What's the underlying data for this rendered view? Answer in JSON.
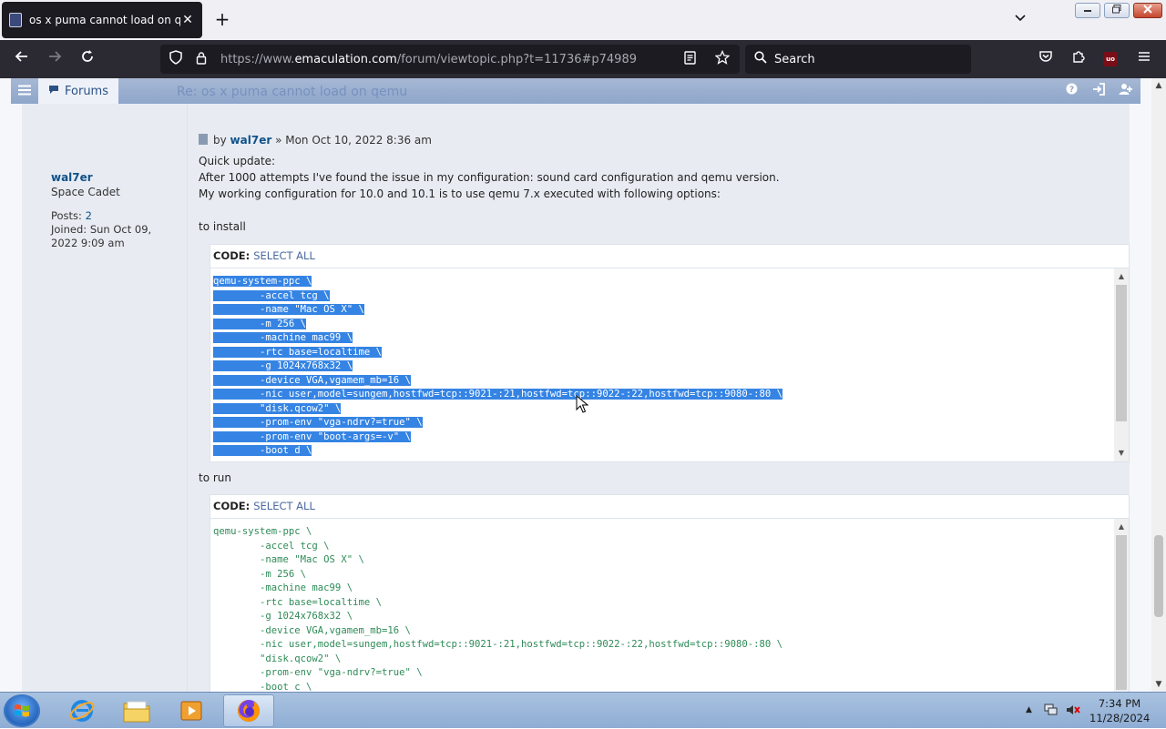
{
  "browser": {
    "tab_title": "os x puma cannot load on qemu",
    "tab_close": "✕",
    "new_tab": "+",
    "url_prefix": "https://www.",
    "url_domain": "emaculation.com",
    "url_rest": "/forum/viewtopic.php?t=11736#p74989",
    "search_placeholder": "Search",
    "ublock_label": "uo"
  },
  "forum_nav": {
    "forums_label": "Forums",
    "ghost_title": "Re: os x puma cannot load on qemu"
  },
  "post": {
    "meta_by": "by",
    "author": "wal7er",
    "meta_date": "» Mon Oct 10, 2022 8:36 am",
    "profile": {
      "username": "wal7er",
      "rank": "Space Cadet",
      "posts_label": "Posts:",
      "posts_count": "2",
      "joined": "Joined: Sun Oct 09, 2022 9:09 am"
    },
    "paragraphs": [
      "Quick update:",
      "After 1000 attempts I've found the issue in my configuration: sound card configuration and qemu version.",
      "My working configuration for 10.0 and 10.1 is to use qemu 7.x executed with following options:"
    ],
    "install_label": "to install",
    "run_label": "to run",
    "code_label": "CODE:",
    "select_all": "SELECT ALL",
    "install_code": [
      "qemu-system-ppc \\",
      "        -accel tcg \\",
      "        -name \"Mac OS X\" \\",
      "        -m 256 \\",
      "        -machine mac99 \\",
      "        -rtc base=localtime \\",
      "        -g 1024x768x32 \\",
      "        -device VGA,vgamem_mb=16 \\",
      "        -nic user,model=sungem,hostfwd=tcp::9021-:21,hostfwd=tcp::9022-:22,hostfwd=tcp::9080-:80 \\",
      "        \"disk.qcow2\" \\",
      "        -prom-env \"vga-ndrv?=true\" \\",
      "        -prom-env \"boot-args=-v\" \\",
      "        -boot d \\"
    ],
    "run_code": [
      "qemu-system-ppc \\",
      "        -accel tcg \\",
      "        -name \"Mac OS X\" \\",
      "        -m 256 \\",
      "        -machine mac99 \\",
      "        -rtc base=localtime \\",
      "        -g 1024x768x32 \\",
      "        -device VGA,vgamem_mb=16 \\",
      "        -nic user,model=sungem,hostfwd=tcp::9021-:21,hostfwd=tcp::9022-:22,hostfwd=tcp::9080-:80 \\",
      "        \"disk.qcow2\" \\",
      "        -prom-env \"vga-ndrv?=true\" \\",
      "        -boot c \\",
      "        &"
    ]
  },
  "taskbar": {
    "time": "7:34 PM",
    "date": "11/28/2024"
  },
  "colors": {
    "selection": "#3584e4",
    "code_text": "#2e8b57",
    "link": "#105289"
  }
}
